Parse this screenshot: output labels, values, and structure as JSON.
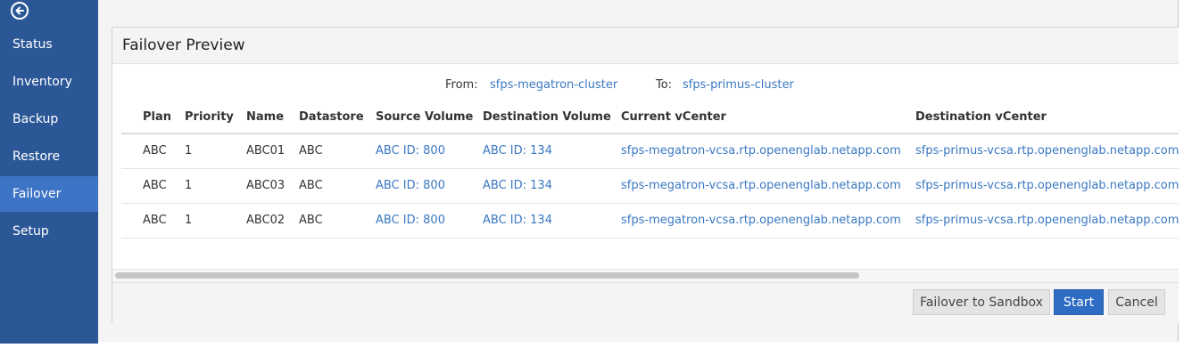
{
  "sidebar": {
    "back_icon": "arrow-left-circle-icon",
    "items": [
      {
        "label": "Status"
      },
      {
        "label": "Inventory"
      },
      {
        "label": "Backup"
      },
      {
        "label": "Restore"
      },
      {
        "label": "Failover",
        "active": true
      },
      {
        "label": "Setup"
      }
    ]
  },
  "panel": {
    "title": "Failover Preview",
    "from_label": "From:",
    "from_value": "sfps-megatron-cluster",
    "to_label": "To:",
    "to_value": "sfps-primus-cluster"
  },
  "table": {
    "headers": [
      "Plan",
      "Priority",
      "Name",
      "Datastore",
      "Source Volume",
      "Destination Volume",
      "Current vCenter",
      "Destination vCenter"
    ],
    "rows": [
      [
        "ABC",
        "1",
        "ABC01",
        "ABC",
        "ABC ID: 800",
        "ABC ID: 134",
        "sfps-megatron-vcsa.rtp.openenglab.netapp.com",
        "sfps-primus-vcsa.rtp.openenglab.netapp.com"
      ],
      [
        "ABC",
        "1",
        "ABC03",
        "ABC",
        "ABC ID: 800",
        "ABC ID: 134",
        "sfps-megatron-vcsa.rtp.openenglab.netapp.com",
        "sfps-primus-vcsa.rtp.openenglab.netapp.com"
      ],
      [
        "ABC",
        "1",
        "ABC02",
        "ABC",
        "ABC ID: 800",
        "ABC ID: 134",
        "sfps-megatron-vcsa.rtp.openenglab.netapp.com",
        "sfps-primus-vcsa.rtp.openenglab.netapp.com"
      ]
    ]
  },
  "footer": {
    "sandbox_label": "Failover to Sandbox",
    "start_label": "Start",
    "cancel_label": "Cancel"
  },
  "colors": {
    "sidebar_bg": "#2b5797",
    "sidebar_active": "#3d74c6",
    "link": "#3a78c2",
    "primary_button": "#2f6cc4"
  }
}
